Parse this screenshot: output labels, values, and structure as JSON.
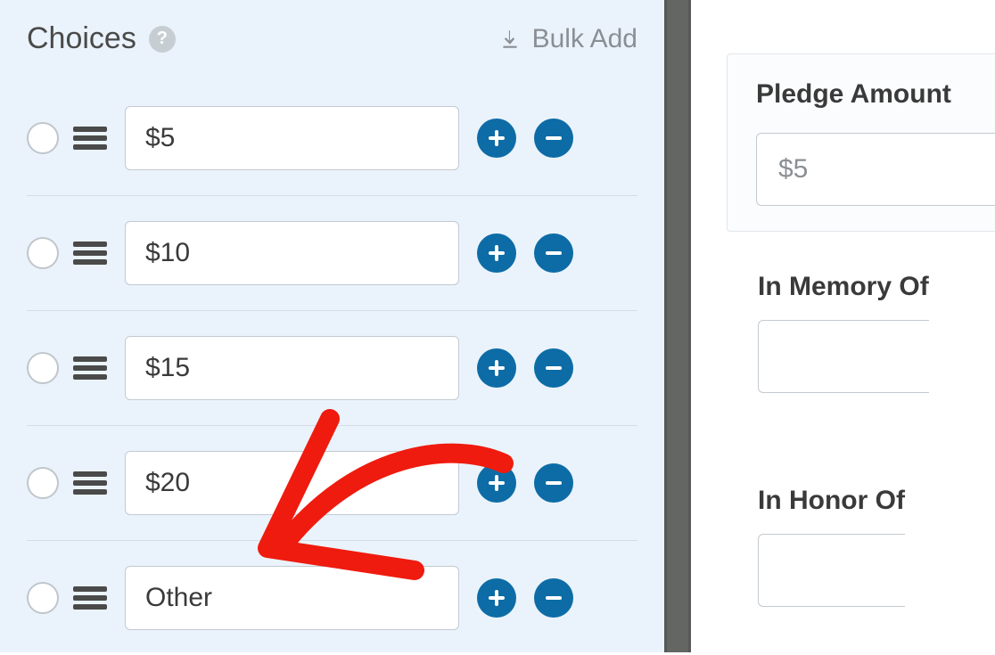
{
  "choices_section": {
    "title": "Choices",
    "bulk_add_label": "Bulk Add",
    "items": [
      {
        "value": "$5"
      },
      {
        "value": "$10"
      },
      {
        "value": "$15"
      },
      {
        "value": "$20"
      },
      {
        "value": "Other"
      }
    ]
  },
  "preview": {
    "pledge_label": "Pledge Amount",
    "pledge_value": "$5",
    "memory_label": "In Memory Of",
    "honor_label": "In Honor Of"
  },
  "ui": {
    "help_glyph": "?",
    "colors": {
      "accent": "#0d6ca6",
      "panel_bg": "#eaf3fb",
      "annotation": "#ef1b0f"
    }
  }
}
